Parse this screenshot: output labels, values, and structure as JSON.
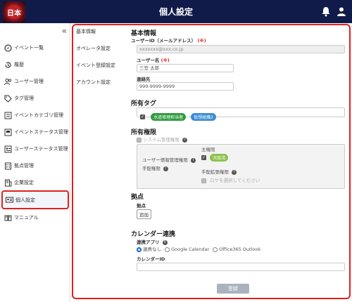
{
  "header": {
    "title": "個人設定",
    "logo_text": "日本"
  },
  "sidebar": {
    "items": [
      {
        "label": "イベント一覧",
        "icon": "compass-icon"
      },
      {
        "label": "履歴",
        "icon": "history-icon"
      },
      {
        "label": "ユーザー管理",
        "icon": "users-icon"
      },
      {
        "label": "タグ管理",
        "icon": "tag-icon"
      },
      {
        "label": "イベントカテゴリ管理",
        "icon": "category-icon"
      },
      {
        "label": "イベントステータス管理",
        "icon": "status-icon"
      },
      {
        "label": "ユーザーステータス管理",
        "icon": "user-status-icon"
      },
      {
        "label": "拠点管理",
        "icon": "building-icon"
      },
      {
        "label": "企業設定",
        "icon": "company-icon"
      },
      {
        "label": "個人設定",
        "icon": "id-card-icon"
      },
      {
        "label": "マニュアル",
        "icon": "book-icon"
      }
    ]
  },
  "subnav": {
    "items": [
      "基本情報",
      "オペレータ設定",
      "イベント登録設定",
      "アカウント設定"
    ]
  },
  "basic": {
    "title": "基本情報",
    "userid_label": "ユーザーID（メールアドレス）",
    "userid_req": "(※)",
    "userid_value": "xxxxxxx@xxx.co.jp",
    "username_label": "ユーザー名",
    "username_req": "(※)",
    "username_value": "三笠 太郎",
    "contact_label": "連絡先",
    "contact_value": "999-9999-9999"
  },
  "tags": {
    "title": "所有タグ",
    "items": [
      {
        "label": "水道修理担当者",
        "color": "#2e9c3e"
      },
      {
        "label": "仮想組織2",
        "color": "#3a8bd6"
      }
    ]
  },
  "permissions": {
    "title": "所有権限",
    "system_admin": "システム管理権限",
    "user_info_admin": "ユーザー情報管理権限",
    "dispatch": "手配権限",
    "main_label": "主権限",
    "main_value": "大阪湾",
    "dispatch_ext": "手配拡張権限",
    "dispatch_ext_placeholder": "ロケを選択してください"
  },
  "base": {
    "title": "拠点",
    "label": "拠点",
    "add_button": "追加"
  },
  "calendar": {
    "title": "カレンダー連携",
    "app_label": "連携アプリ",
    "options": [
      "連携なし",
      "Google Calendar",
      "Office365 Outlook"
    ],
    "calendar_id_label": "カレンダーID"
  },
  "register_button": "登録"
}
